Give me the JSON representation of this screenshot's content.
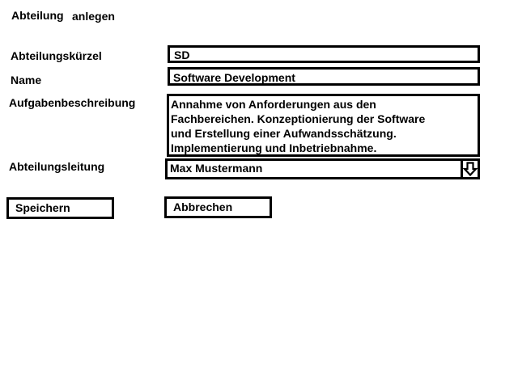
{
  "title": {
    "word1": "Abteilung",
    "word2": "anlegen"
  },
  "form": {
    "kuerzel": {
      "label": "Abteilungskürzel",
      "value": "SD"
    },
    "name": {
      "label": "Name",
      "value": "Software Development"
    },
    "beschreibung": {
      "label": "Aufgabenbeschreibung",
      "value": "Annahme von Anforderungen aus den\nFachbereichen. Konzeptionierung der Software\nund Erstellung einer Aufwandsschätzung.\nImplementierung und Inbetriebnahme."
    },
    "leitung": {
      "label": "Abteilungsleitung",
      "value": "Max Mustermann",
      "dropdown_icon": "arrow-down-outline-icon"
    }
  },
  "buttons": {
    "save_label": "Speichern",
    "cancel_label": "Abbrechen"
  }
}
